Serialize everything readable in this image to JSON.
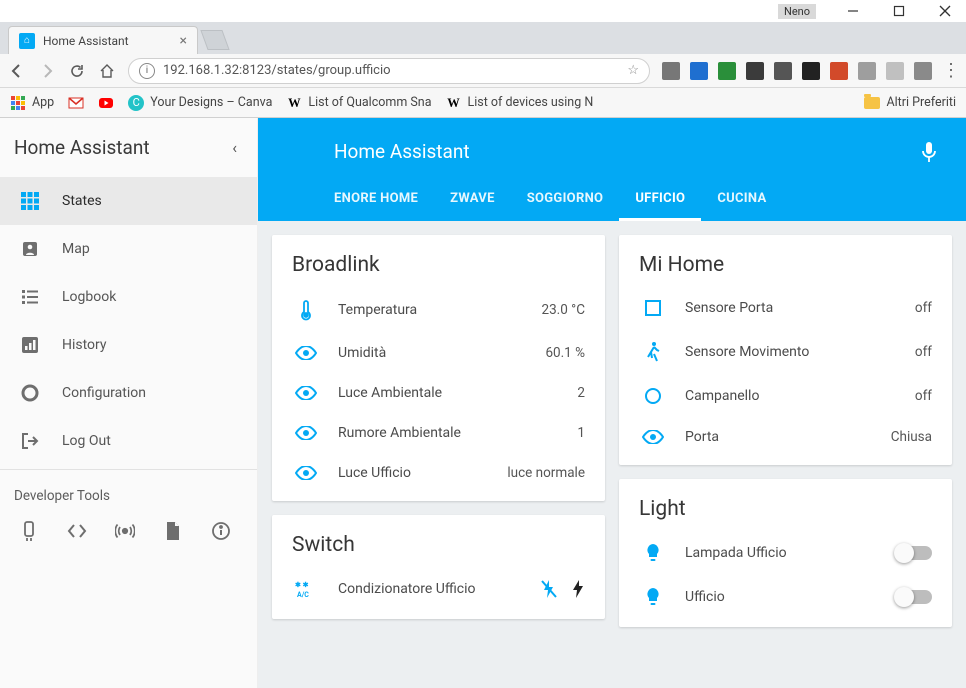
{
  "window": {
    "user": "Neno"
  },
  "browser": {
    "tab_title": "Home Assistant",
    "url": "192.168.1.32:8123/states/group.ufficio",
    "bookmarks": {
      "app": "App",
      "designs": "Your Designs – Canva",
      "qualcomm": "List of Qualcomm Sna",
      "devices": "List of devices using N",
      "altri": "Altri Preferiti"
    }
  },
  "sidebar": {
    "title": "Home Assistant",
    "items": {
      "states": "States",
      "map": "Map",
      "logbook": "Logbook",
      "history": "History",
      "config": "Configuration",
      "logout": "Log Out"
    },
    "devtools": "Developer Tools"
  },
  "appbar": {
    "title": "Home Assistant",
    "tabs": {
      "enore": "ENORE HOME",
      "zwave": "ZWAVE",
      "soggiorno": "SOGGIORNO",
      "ufficio": "UFFICIO",
      "cucina": "CUCINA"
    }
  },
  "cards": {
    "broadlink": {
      "title": "Broadlink",
      "rows": [
        {
          "label": "Temperatura",
          "value": "23.0 °C"
        },
        {
          "label": "Umidità",
          "value": "60.1 %"
        },
        {
          "label": "Luce Ambientale",
          "value": "2"
        },
        {
          "label": "Rumore Ambientale",
          "value": "1"
        },
        {
          "label": "Luce Ufficio",
          "value": "luce normale"
        }
      ]
    },
    "switch": {
      "title": "Switch",
      "rows": [
        {
          "label": "Condizionatore Ufficio"
        }
      ]
    },
    "mihome": {
      "title": "Mi Home",
      "rows": [
        {
          "label": "Sensore Porta",
          "value": "off"
        },
        {
          "label": "Sensore Movimento",
          "value": "off"
        },
        {
          "label": "Campanello",
          "value": "off"
        },
        {
          "label": "Porta",
          "value": "Chiusa"
        }
      ]
    },
    "light": {
      "title": "Light",
      "rows": [
        {
          "label": "Lampada Ufficio"
        },
        {
          "label": "Ufficio"
        }
      ]
    }
  }
}
